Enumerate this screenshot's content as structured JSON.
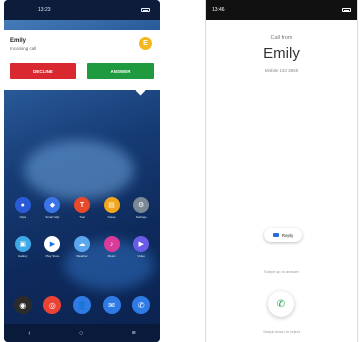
{
  "left": {
    "status_time": "13:23",
    "notification": {
      "caller_name": "Emily",
      "subtitle": "Incoming call",
      "avatar_letter": "E",
      "decline_label": "DECLINE",
      "answer_label": "ANSWER"
    },
    "colors": {
      "decline": "#d9282f",
      "answer": "#1f9a3e",
      "avatar": "#f5b81c"
    },
    "row1": [
      {
        "label": "Clips",
        "icon": "video-icon",
        "glyph": "●",
        "color": "#2a5bd7"
      },
      {
        "label": "Smart Mgr",
        "icon": "shield-icon",
        "glyph": "◆",
        "color": "#3a74e8"
      },
      {
        "label": "Tusi",
        "icon": "tusi-icon",
        "glyph": "T",
        "color": "#e8492b"
      },
      {
        "label": "Notes",
        "icon": "notes-icon",
        "glyph": "▤",
        "color": "#f3a61a"
      },
      {
        "label": "Settings",
        "icon": "settings-icon",
        "glyph": "⚙",
        "color": "#7b8896"
      }
    ],
    "row2": [
      {
        "label": "Gallery",
        "icon": "gallery-icon",
        "glyph": "▣",
        "color": "#3fa8e6"
      },
      {
        "label": "Play Store",
        "icon": "play-store-icon",
        "glyph": "▶",
        "color": "#ffffff"
      },
      {
        "label": "Weather",
        "icon": "weather-icon",
        "glyph": "☁",
        "color": "#5aa7f0"
      },
      {
        "label": "Music",
        "icon": "music-icon",
        "glyph": "♪",
        "color": "#d93b9a"
      },
      {
        "label": "Video",
        "icon": "video-player-icon",
        "glyph": "▶",
        "color": "#6b5ce7"
      }
    ],
    "dock": [
      {
        "icon": "camera-icon",
        "glyph": "◉",
        "color": "#2b2b2b"
      },
      {
        "icon": "chrome-icon",
        "glyph": "◎",
        "color": "#ea4335"
      },
      {
        "icon": "contacts-icon",
        "glyph": "👤",
        "color": "#2f7be6"
      },
      {
        "icon": "messages-icon",
        "glyph": "✉",
        "color": "#2f7be6"
      },
      {
        "icon": "phone-icon",
        "glyph": "✆",
        "color": "#2f7be6"
      }
    ],
    "nav": {
      "back": "‹",
      "home": "○",
      "recents": "≡"
    }
  },
  "right": {
    "status_time": "13:46",
    "call_from": "Call from",
    "caller_name": "Emily",
    "number": "Mobile 133 3665",
    "reply_label": "Reply",
    "swipe_up": "Swipe up to answer",
    "swipe_down": "Swipe down to reject",
    "answer_color": "#1e9e4a"
  }
}
